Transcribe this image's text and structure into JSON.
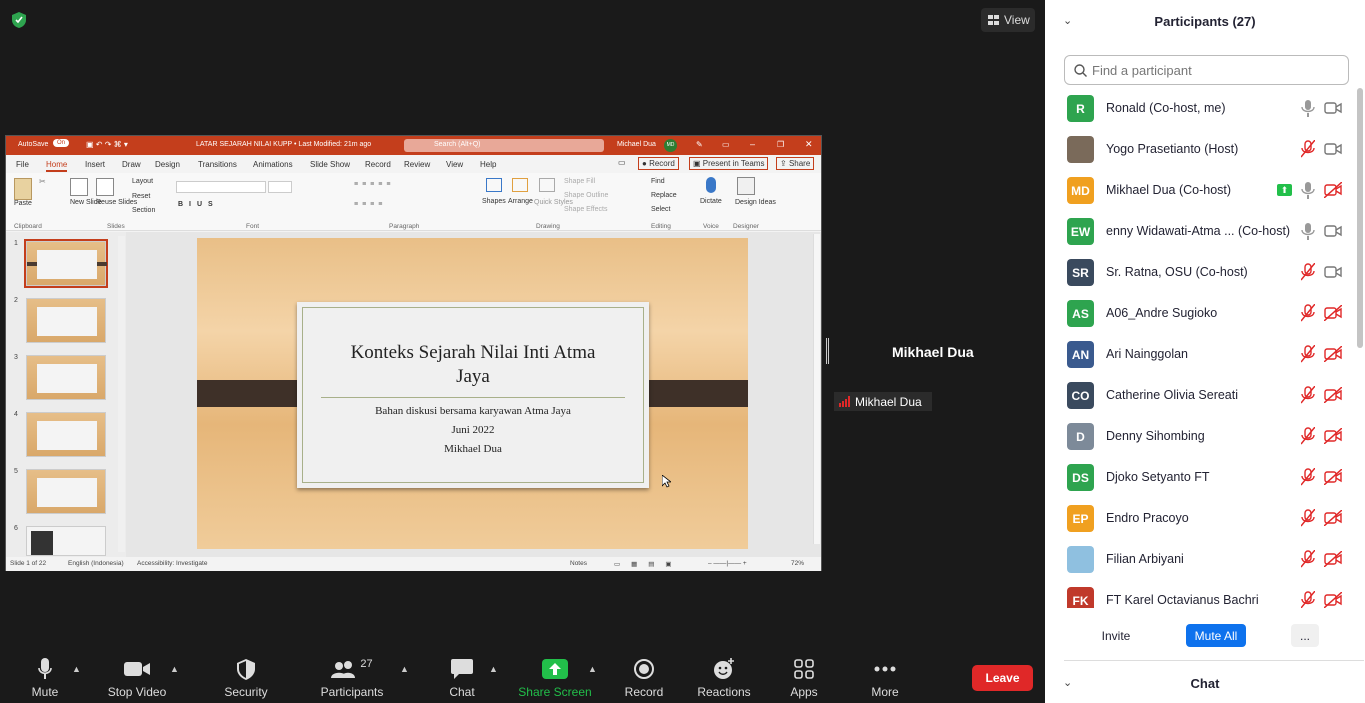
{
  "meeting": {
    "view_label": "View"
  },
  "ppt": {
    "autosave": "AutoSave",
    "autosave_state": "On",
    "title": "LATAR SEJARAH NILAI KUPP • Last Modified: 21m ago",
    "search": "Search (Alt+Q)",
    "user": "Michael Dua",
    "user_initials": "MD",
    "menu": [
      "File",
      "Home",
      "Insert",
      "Draw",
      "Design",
      "Transitions",
      "Animations",
      "Slide Show",
      "Record",
      "Review",
      "View",
      "Help"
    ],
    "record_btn": "Record",
    "present_btn": "Present in Teams",
    "share_btn": "Share",
    "groups": [
      "Clipboard",
      "Slides",
      "Font",
      "Paragraph",
      "Drawing",
      "Editing",
      "Voice",
      "Designer"
    ],
    "ribbon": {
      "paste": "Paste",
      "new_slide": "New Slide",
      "reuse": "Reuse Slides",
      "layout": "Layout",
      "reset": "Reset",
      "section": "Section",
      "shapes": "Shapes",
      "arrange": "Arrange",
      "quick_styles": "Quick Styles",
      "shape_fill": "Shape Fill",
      "shape_outline": "Shape Outline",
      "shape_effects": "Shape Effects",
      "find": "Find",
      "replace": "Replace",
      "select": "Select",
      "dictate": "Dictate",
      "design_ideas": "Design Ideas"
    },
    "slide": {
      "title_line1": "Konteks Sejarah Nilai Inti Atma",
      "title_line2": "Jaya",
      "sub1": "Bahan diskusi bersama karyawan Atma Jaya",
      "sub2": "Juni 2022",
      "sub3": "Mikhael Dua"
    },
    "thumb_numbers": [
      "1",
      "2",
      "3",
      "4",
      "5",
      "6"
    ],
    "status": {
      "slide": "Slide 1 of 22",
      "lang": "English (Indonesia)",
      "access": "Accessibility: Investigate",
      "notes": "Notes",
      "zoom": "72%"
    }
  },
  "speaker": {
    "name": "Mikhael Dua",
    "label": "Mikhael Dua"
  },
  "toolbar": {
    "mute": "Mute",
    "stop_video": "Stop Video",
    "security": "Security",
    "participants": "Participants",
    "participants_count": "27",
    "chat": "Chat",
    "share_screen": "Share Screen",
    "record": "Record",
    "reactions": "Reactions",
    "apps": "Apps",
    "more": "More",
    "leave": "Leave"
  },
  "panel": {
    "title": "Participants (27)",
    "search_placeholder": "Find a participant",
    "participants": [
      {
        "initials": "R",
        "name": "Ronald (Co-host, me)",
        "color": "#2ea44f",
        "mic": "on",
        "cam": "on"
      },
      {
        "initials": "",
        "name": "Yogo Prasetianto (Host)",
        "color": "#7a6a5a",
        "mic": "muted",
        "cam": "on"
      },
      {
        "initials": "MD",
        "name": "Mikhael Dua (Co-host)",
        "color": "#f0a020",
        "mic": "on",
        "cam": "off",
        "sharing": true
      },
      {
        "initials": "EW",
        "name": "enny Widawati-Atma ... (Co-host)",
        "color": "#2ea44f",
        "mic": "on",
        "cam": "on"
      },
      {
        "initials": "SR",
        "name": "Sr. Ratna, OSU (Co-host)",
        "color": "#3a4a5e",
        "mic": "muted",
        "cam": "on"
      },
      {
        "initials": "AS",
        "name": "A06_Andre Sugioko",
        "color": "#2ea44f",
        "mic": "muted",
        "cam": "off"
      },
      {
        "initials": "AN",
        "name": "Ari Nainggolan",
        "color": "#3a5a8e",
        "mic": "muted",
        "cam": "off"
      },
      {
        "initials": "CO",
        "name": "Catherine Olivia Sereati",
        "color": "#3a4a5e",
        "mic": "muted",
        "cam": "off"
      },
      {
        "initials": "D",
        "name": "Denny Sihombing",
        "color": "#7d8a99",
        "mic": "muted",
        "cam": "off"
      },
      {
        "initials": "DS",
        "name": "Djoko Setyanto FT",
        "color": "#2ea44f",
        "mic": "muted",
        "cam": "off"
      },
      {
        "initials": "EP",
        "name": "Endro Pracoyo",
        "color": "#f0a020",
        "mic": "muted",
        "cam": "off"
      },
      {
        "initials": "",
        "name": "Filian Arbiyani",
        "color": "#8fc0e0",
        "mic": "muted",
        "cam": "off"
      },
      {
        "initials": "FK",
        "name": "FT Karel Octavianus Bachri",
        "color": "#c0392b",
        "mic": "muted",
        "cam": "off"
      }
    ],
    "invite": "Invite",
    "mute_all": "Mute All",
    "more": "...",
    "chat_title": "Chat"
  },
  "colors": {
    "accent": "#0e72ed",
    "leave": "#e02828",
    "ppt_red": "#c43e1c",
    "share_green": "#22bf4a"
  }
}
